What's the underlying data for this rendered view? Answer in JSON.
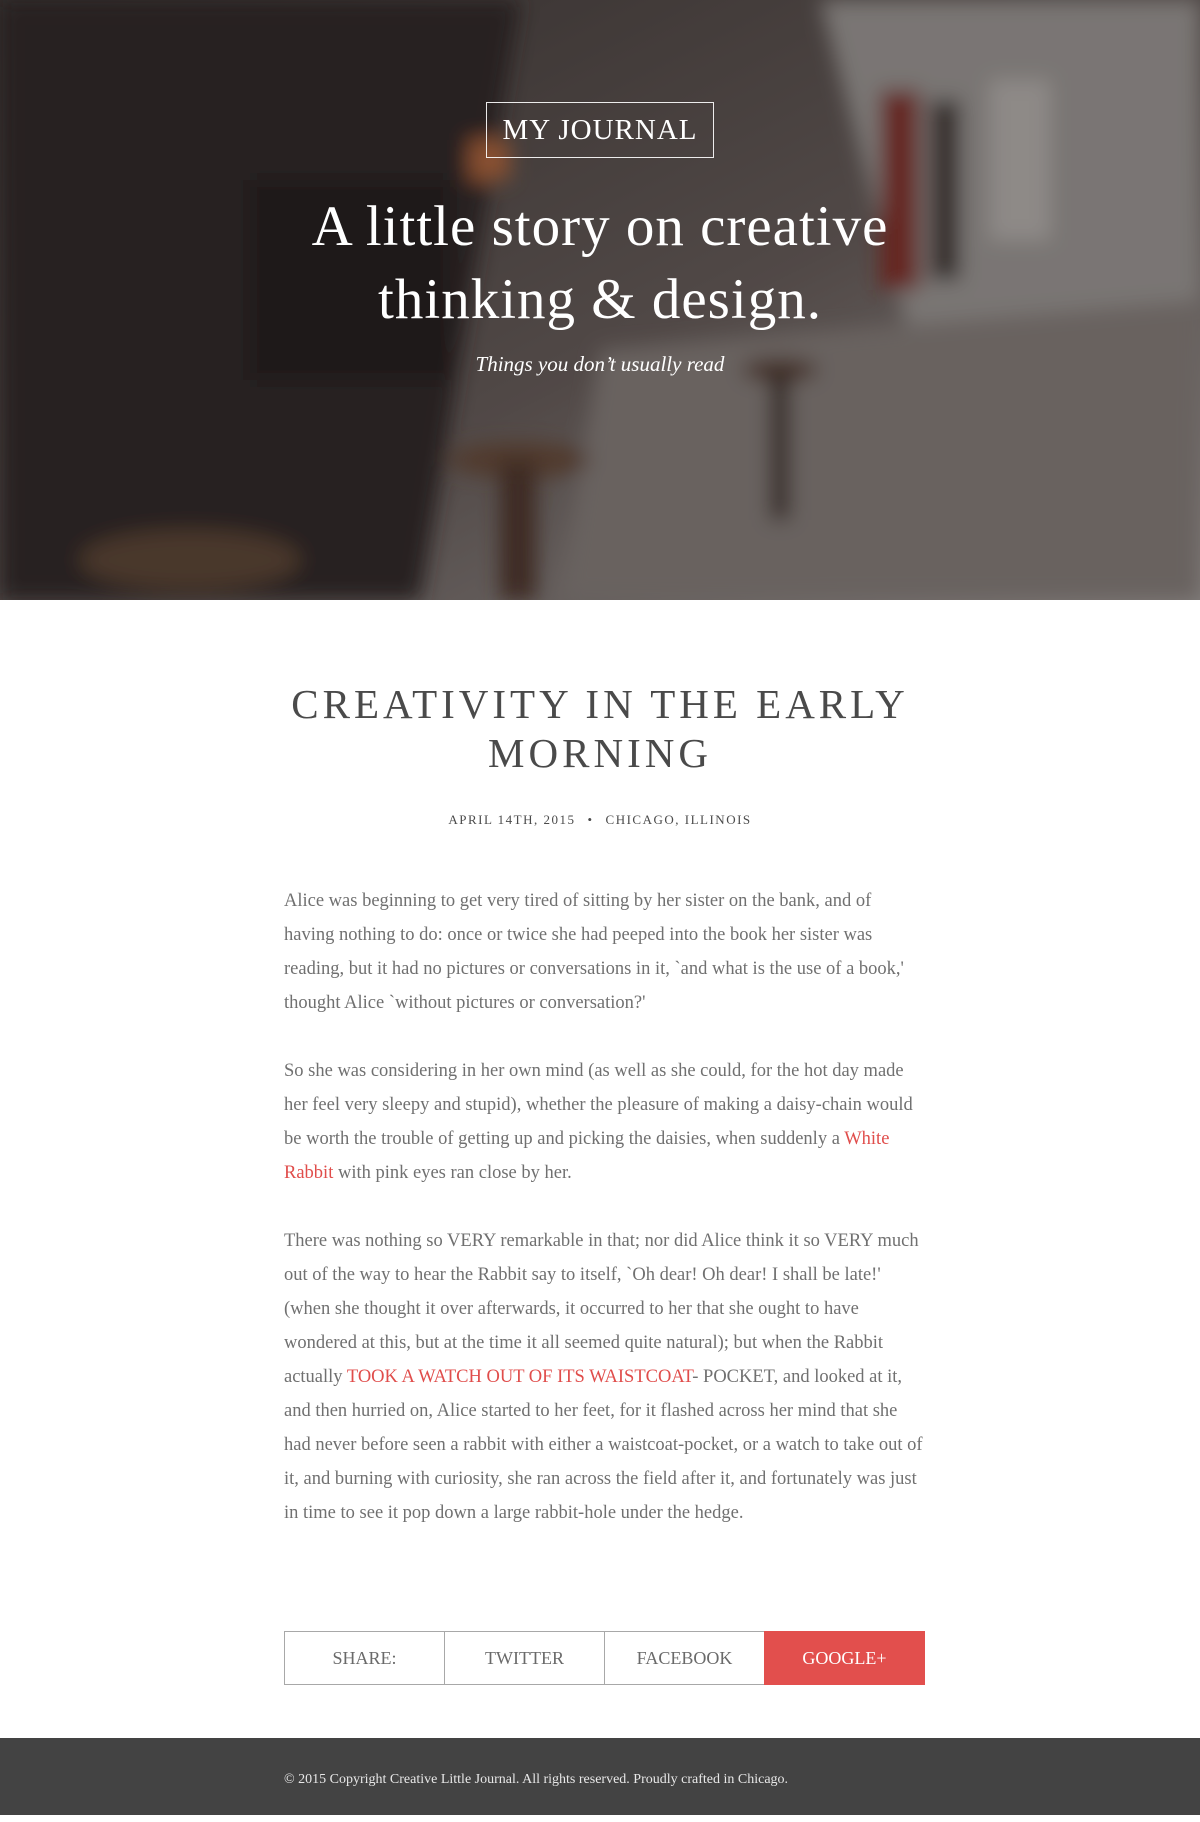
{
  "hero": {
    "brand": "MY JOURNAL",
    "headline_line1": "A little story on creative",
    "headline_line2": "thinking & design.",
    "tagline": "Things you don’t usually read"
  },
  "post": {
    "title_line1": "CREATIVITY IN THE EARLY",
    "title_line2": "MORNING",
    "date": "APRIL 14TH, 2015",
    "location": "CHICAGO, ILLINOIS",
    "paragraphs": {
      "p1": "Alice was beginning to get very tired of sitting by her sister on the bank, and of having nothing to do: once or twice she had peeped into the book her sister was reading, but it had no pictures or conversations in it, `and what is the use of a book,' thought Alice `without pictures or conversation?'",
      "p2_before": "So she was considering in her own mind (as well as she could, for the hot day made her feel very sleepy and stupid), whether the pleasure of making a daisy-chain would be worth the trouble of getting up and picking the daisies, when suddenly a ",
      "p2_link": "White Rabbit",
      "p2_after": " with pink eyes ran close by her.",
      "p3_before": "There was nothing so VERY remarkable in that; nor did Alice think it so VERY much out of the way to hear the Rabbit say to itself, `Oh dear! Oh dear! I shall be late!' (when she thought it over afterwards, it occurred to her that she ought to have wondered at this, but at the time it all seemed quite natural); but when the Rabbit actually ",
      "p3_link": "TOOK A WATCH OUT OF ITS WAISTCOAT",
      "p3_after": "- POCKET, and looked at it, and then hurried on, Alice started to her feet, for it flashed across her mind that she had never before seen a rabbit with either a waistcoat-pocket, or a watch to take out of it, and burning with curiosity, she ran across the field after it, and fortunately was just in time to see it pop down a large rabbit-hole under the hedge."
    }
  },
  "share": {
    "label": "SHARE:",
    "twitter": "TWITTER",
    "facebook": "FACEBOOK",
    "googleplus": "GOOGLE+"
  },
  "footer": {
    "copyright": "© 2015 Copyright Creative Little Journal. All rights reserved. Proudly crafted in Chicago."
  },
  "colors": {
    "accent": "#e24f4d",
    "footer_bg": "#434343",
    "title_text": "#4a4a4a",
    "body_text": "#707070"
  }
}
